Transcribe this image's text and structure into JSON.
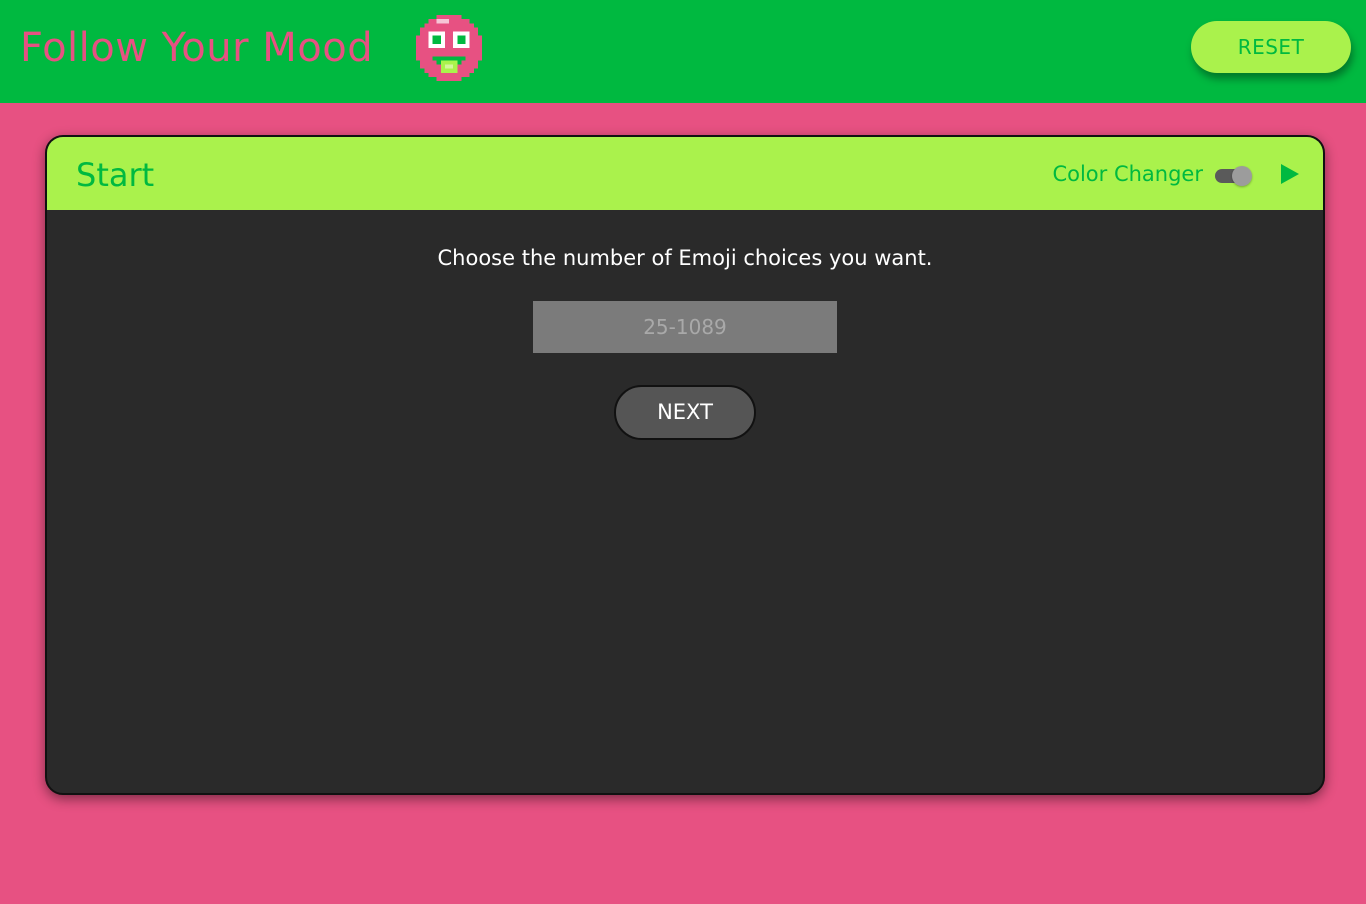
{
  "header": {
    "app_title": "Follow Your Mood",
    "logo_icon": "pixel-smiley-face-icon",
    "reset_label": "RESET"
  },
  "panel": {
    "title": "Start",
    "color_changer_label": "Color Changer",
    "color_changer_on": true,
    "play_icon": "play-triangle-icon",
    "prompt": "Choose the number of Emoji choices you want.",
    "count_input": {
      "value": "",
      "placeholder": "25-1089"
    },
    "next_label": "NEXT"
  },
  "colors": {
    "page_background": "#e75182",
    "header_background": "#00b940",
    "accent_lime": "#aaf24c",
    "panel_background": "#2a2a2a",
    "input_background": "#7b7b7b",
    "button_background": "#555555"
  }
}
